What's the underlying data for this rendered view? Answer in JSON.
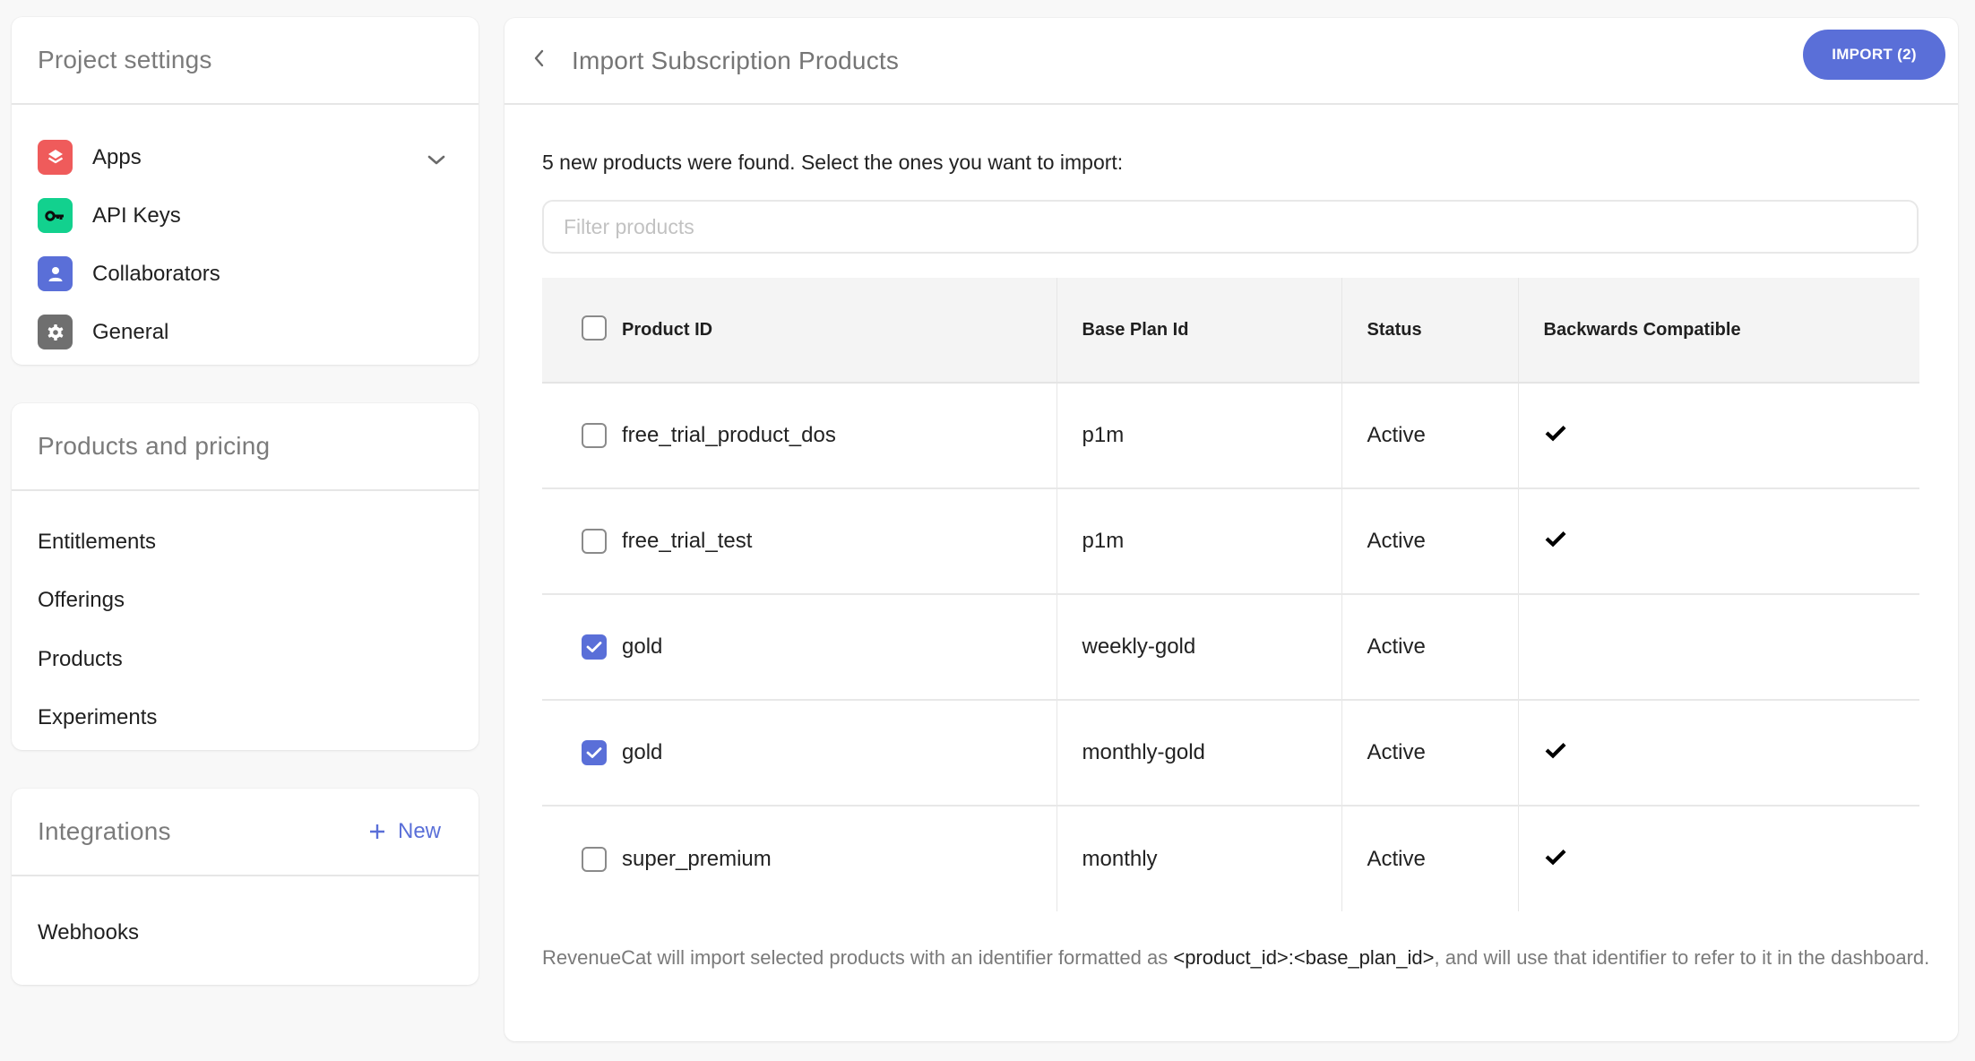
{
  "sidebar": {
    "project_settings": {
      "title": "Project settings",
      "items": [
        {
          "label": "Apps",
          "icon": "apps-layers-icon",
          "color": "#ef5b5b",
          "has_chevron": true
        },
        {
          "label": "API Keys",
          "icon": "key-icon",
          "color": "#12d18e"
        },
        {
          "label": "Collaborators",
          "icon": "user-icon",
          "color": "#5a6fd8"
        },
        {
          "label": "General",
          "icon": "gear-icon",
          "color": "#6f6f6f"
        }
      ]
    },
    "products_pricing": {
      "title": "Products and pricing",
      "items": [
        {
          "label": "Entitlements"
        },
        {
          "label": "Offerings"
        },
        {
          "label": "Products"
        },
        {
          "label": "Experiments"
        }
      ]
    },
    "integrations": {
      "title": "Integrations",
      "new_label": "New",
      "new_icon": "plus-icon",
      "items": [
        {
          "label": "Webhooks"
        }
      ]
    }
  },
  "main": {
    "title": "Import Subscription Products",
    "back_icon": "chevron-left-icon",
    "import_button": "IMPORT (2)",
    "intro": "5 new products were found. Select the ones you want to import:",
    "filter": {
      "placeholder": "Filter products",
      "value": ""
    },
    "table": {
      "columns": [
        "Product ID",
        "Base Plan Id",
        "Status",
        "Backwards Compatible"
      ],
      "select_all_checked": false,
      "rows": [
        {
          "product_id": "free_trial_product_dos",
          "base_plan_id": "p1m",
          "status": "Active",
          "backwards_compatible": true,
          "selected": false
        },
        {
          "product_id": "free_trial_test",
          "base_plan_id": "p1m",
          "status": "Active",
          "backwards_compatible": true,
          "selected": false
        },
        {
          "product_id": "gold",
          "base_plan_id": "weekly-gold",
          "status": "Active",
          "backwards_compatible": false,
          "selected": true
        },
        {
          "product_id": "gold",
          "base_plan_id": "monthly-gold",
          "status": "Active",
          "backwards_compatible": true,
          "selected": true
        },
        {
          "product_id": "super_premium",
          "base_plan_id": "monthly",
          "status": "Active",
          "backwards_compatible": true,
          "selected": false
        }
      ]
    },
    "footnote": {
      "before": "RevenueCat will import selected products with an identifier formatted as ",
      "code": "<product_id>:<base_plan_id>",
      "after": ", and will use that identifier to refer to it in the dashboard."
    }
  },
  "colors": {
    "accent": "#5a6fd8",
    "background": "#f8f8f8",
    "muted_text": "#7a7a7a"
  }
}
